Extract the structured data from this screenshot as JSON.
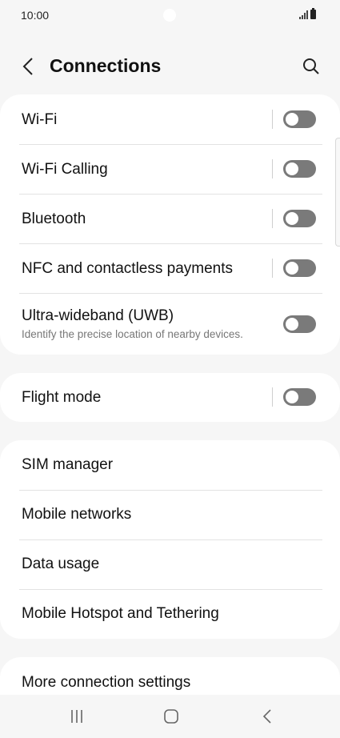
{
  "status_bar": {
    "time": "10:00"
  },
  "header": {
    "title": "Connections"
  },
  "group1": {
    "wifi": {
      "label": "Wi-Fi",
      "toggle": "off"
    },
    "wifi_calling": {
      "label": "Wi-Fi Calling",
      "toggle": "off"
    },
    "bluetooth": {
      "label": "Bluetooth",
      "toggle": "off"
    },
    "nfc": {
      "label": "NFC and contactless payments",
      "toggle": "off"
    },
    "uwb": {
      "label": "Ultra-wideband (UWB)",
      "subtitle": "Identify the precise location of nearby devices.",
      "toggle": "off"
    }
  },
  "group2": {
    "flight_mode": {
      "label": "Flight mode",
      "toggle": "off"
    }
  },
  "group3": {
    "items": [
      {
        "label": "SIM manager"
      },
      {
        "label": "Mobile networks"
      },
      {
        "label": "Data usage"
      },
      {
        "label": "Mobile Hotspot and Tethering"
      }
    ]
  },
  "group4": {
    "more": {
      "label": "More connection settings"
    }
  },
  "colors": {
    "background": "#f6f6f6",
    "card": "#ffffff",
    "toggle_off": "#7a7a7a"
  }
}
